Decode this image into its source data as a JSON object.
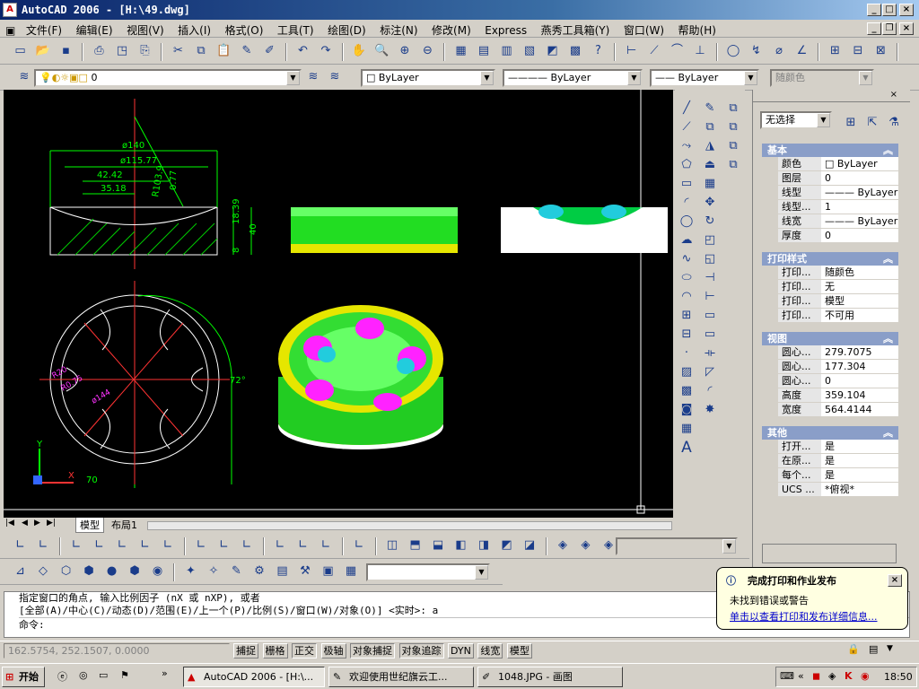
{
  "window": {
    "title": "AutoCAD 2006 - [H:\\49.dwg]"
  },
  "menu": [
    "文件(F)",
    "编辑(E)",
    "视图(V)",
    "插入(I)",
    "格式(O)",
    "工具(T)",
    "绘图(D)",
    "标注(N)",
    "修改(M)",
    "Express",
    "燕秀工具箱(Y)",
    "窗口(W)",
    "帮助(H)"
  ],
  "layers": {
    "current": "0"
  },
  "object_props": {
    "color": "ByLayer",
    "linetype": "ByLayer",
    "lineweight": "ByLayer",
    "plotstyle": "随颜色"
  },
  "drawing": {
    "dims": [
      "ø140",
      "ø115.77",
      "42.42",
      "35.18",
      "R103.9",
      "0.77",
      "18.39",
      "40",
      "8",
      "ø144",
      "R20",
      "R0.75",
      "72°",
      "70",
      "R20.66"
    ],
    "ucs": {
      "x": "X",
      "y": "Y"
    }
  },
  "layout_tabs": [
    "模型",
    "布局1"
  ],
  "properties": {
    "selection": "无选择",
    "sections": [
      {
        "title": "基本",
        "rows": [
          [
            "颜色",
            "ByLayer"
          ],
          [
            "图层",
            "0"
          ],
          [
            "线型",
            "ByLayer"
          ],
          [
            "线型...",
            "1"
          ],
          [
            "线宽",
            "ByLayer"
          ],
          [
            "厚度",
            "0"
          ]
        ]
      },
      {
        "title": "打印样式",
        "rows": [
          [
            "打印...",
            "随颜色"
          ],
          [
            "打印...",
            "无"
          ],
          [
            "打印...",
            "模型"
          ],
          [
            "打印...",
            "不可用"
          ]
        ]
      },
      {
        "title": "视图",
        "rows": [
          [
            "圆心...",
            "279.7075"
          ],
          [
            "圆心...",
            "177.304"
          ],
          [
            "圆心...",
            "0"
          ],
          [
            "高度",
            "359.104"
          ],
          [
            "宽度",
            "564.4144"
          ]
        ]
      },
      {
        "title": "其他",
        "rows": [
          [
            "打开...",
            "是"
          ],
          [
            "在原...",
            "是"
          ],
          [
            "每个...",
            "是"
          ],
          [
            "UCS ...",
            "*俯视*"
          ]
        ]
      }
    ]
  },
  "command": {
    "line1": "指定窗口的角点, 输入比例因子 (nX 或 nXP), 或者",
    "line2": "[全部(A)/中心(C)/动态(D)/范围(E)/上一个(P)/比例(S)/窗口(W)/对象(O)] <实时>: a",
    "prompt": "命令:"
  },
  "status": {
    "coords": "162.5754, 252.1507, 0.0000",
    "toggles": [
      "捕捉",
      "栅格",
      "正交",
      "极轴",
      "对象捕捉",
      "对象追踪",
      "DYN",
      "线宽",
      "模型"
    ]
  },
  "balloon": {
    "title": "完成打印和作业发布",
    "line1": "未找到错误或警告",
    "link": "单击以查看打印和发布详细信息..."
  },
  "taskbar": {
    "start": "开始",
    "tasks": [
      "AutoCAD 2006 - [H:\\...",
      "欢迎使用世纪旗云工...",
      "1048.JPG - 画图"
    ],
    "clock": "18:50"
  },
  "colors": {
    "title": "#0a246a",
    "viewport": "#000000",
    "accent": "#00ff00"
  }
}
